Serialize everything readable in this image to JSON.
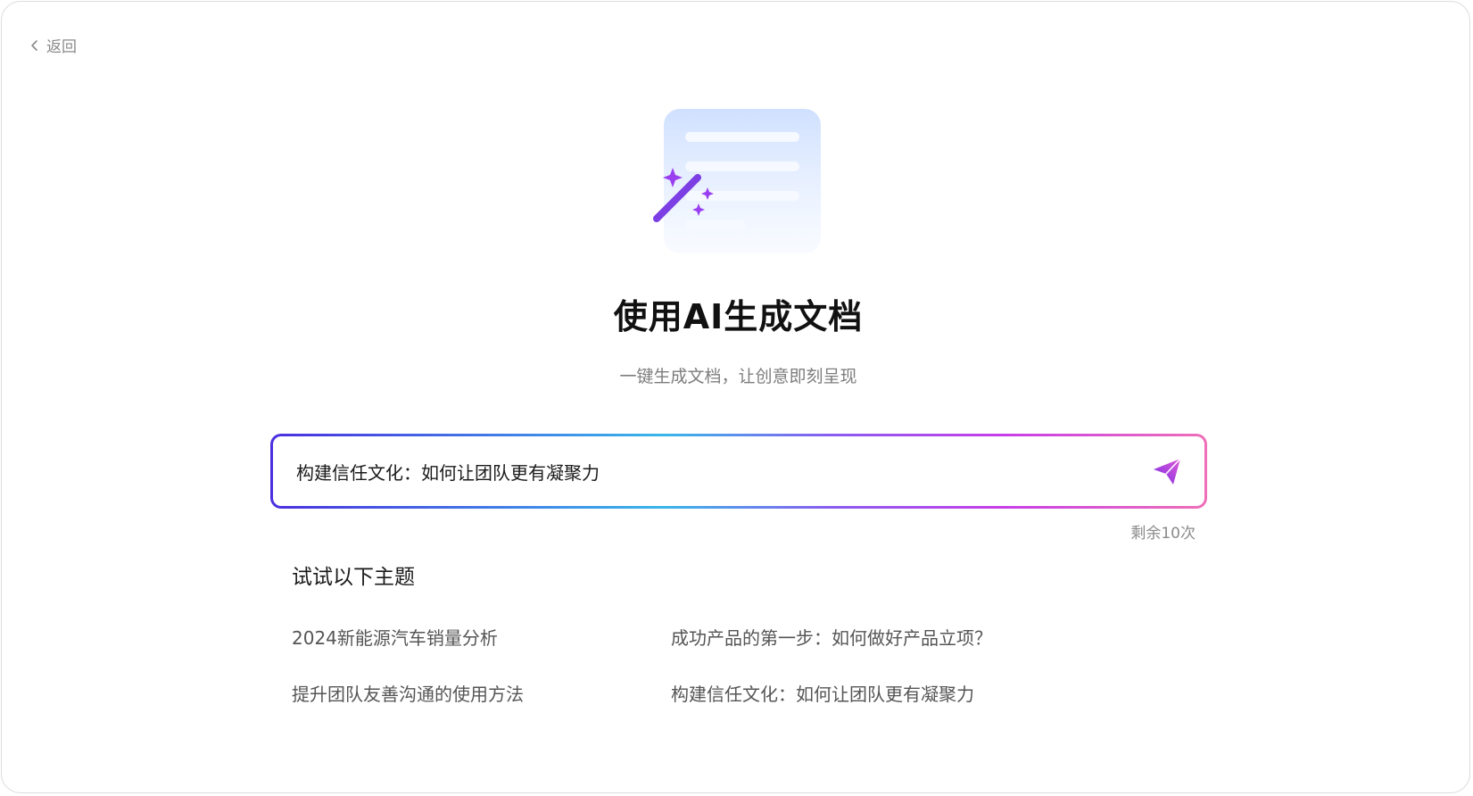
{
  "nav": {
    "back_label": "返回"
  },
  "hero": {
    "icon": "magic-document-icon",
    "title": "使用AI生成文档",
    "subtitle": "一键生成文档，让创意即刻呈现"
  },
  "prompt": {
    "value": "构建信任文化：如何让团队更有凝聚力",
    "send_icon": "send-icon",
    "remaining": "剩余10次"
  },
  "suggestions": {
    "title": "试试以下主题",
    "items": [
      "2024新能源汽车销量分析",
      "成功产品的第一步：如何做好产品立项？",
      "提升团队友善沟通的使用方法",
      "构建信任文化：如何让团队更有凝聚力"
    ]
  },
  "colors": {
    "accent_start": "#4a2fe0",
    "accent_mid": "#39b6e8",
    "accent_end": "#ee6fb8",
    "wand": "#7b3fe4"
  }
}
